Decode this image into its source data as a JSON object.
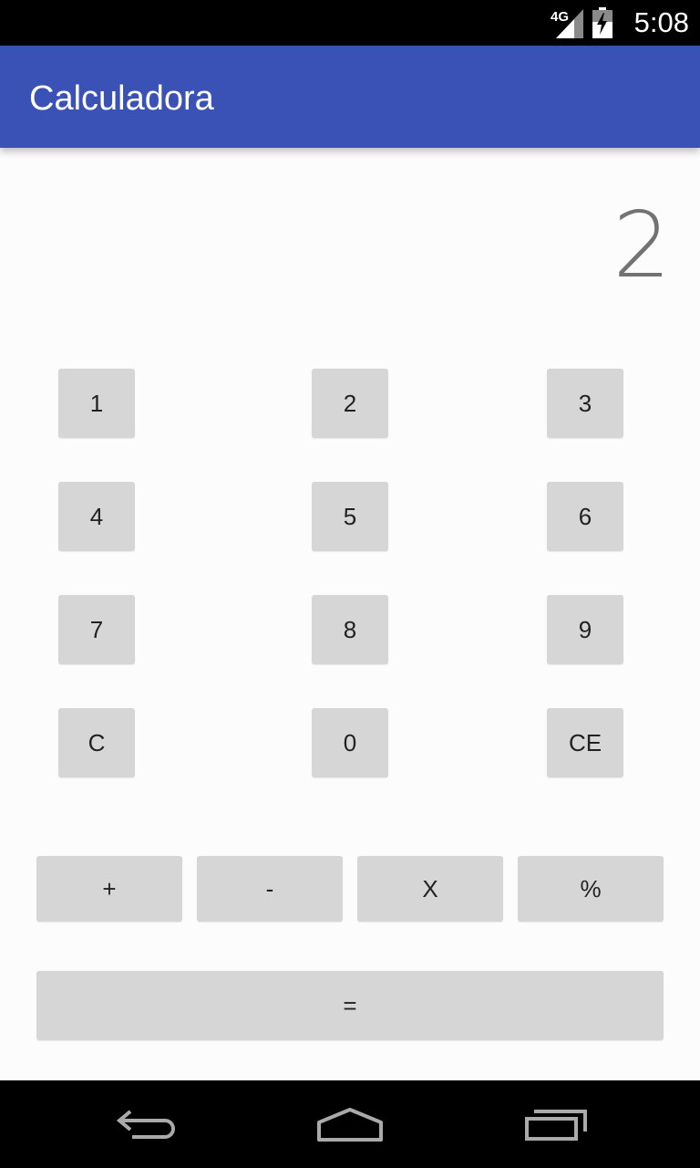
{
  "status_bar": {
    "network": "4G",
    "time": "5:08"
  },
  "app_bar": {
    "title": "Calculadora"
  },
  "display": {
    "value": "2"
  },
  "keypad": {
    "digits": [
      "1",
      "2",
      "3",
      "4",
      "5",
      "6",
      "7",
      "8",
      "9",
      "C",
      "0",
      "CE"
    ],
    "operators": [
      "+",
      "-",
      "X",
      "%"
    ],
    "equals": "="
  },
  "colors": {
    "app_bar": "#3a52b5",
    "button": "#d6d6d6",
    "background": "#fdfcfd",
    "display_text": "#737373"
  },
  "nav_bar": {
    "icons": [
      "back-icon",
      "home-icon",
      "recent-apps-icon"
    ]
  }
}
